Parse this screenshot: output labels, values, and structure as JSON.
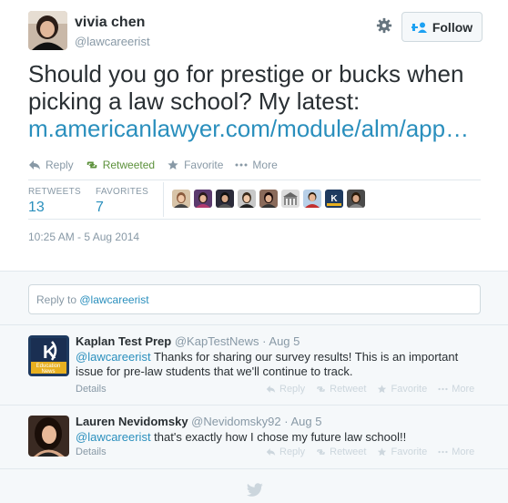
{
  "tweet": {
    "fullname": "vivia chen",
    "username": "@lawcareerist",
    "follow_label": "Follow",
    "text_line1": "Should you go for prestige or bucks when",
    "text_line2": "picking a law school? My latest:",
    "link": "m.americanlawyer.com/module/alm/app…",
    "actions": {
      "reply": "Reply",
      "retweeted": "Retweeted",
      "favorite": "Favorite",
      "more": "More"
    },
    "stats": {
      "retweets_label": "RETWEETS",
      "retweets_value": "13",
      "favorites_label": "FAVORITES",
      "favorites_value": "7"
    },
    "timestamp": "10:25 AM - 5 Aug 2014"
  },
  "reply_box": {
    "prefix": "Reply to ",
    "mention": "@lawcareerist"
  },
  "replies": [
    {
      "name": "Kaplan Test Prep",
      "handle": "@KapTestNews",
      "date": "· Aug 5",
      "mention": "@lawcareerist",
      "text": " Thanks for sharing our survey results! This is an important issue for pre-law students that we'll continue to track.",
      "details": "Details",
      "reply": "Reply",
      "retweet": "Retweet",
      "favorite": "Favorite",
      "more": "More",
      "avatar_text_k": "K",
      "avatar_text_1": "Education",
      "avatar_text_2": "News"
    },
    {
      "name": "Lauren Nevidomsky",
      "handle": "@Nevidomsky92",
      "date": "· Aug 5",
      "mention": "@lawcareerist",
      "text": " that's exactly how I chose my future law school!!",
      "details": "Details",
      "reply": "Reply",
      "retweet": "Retweet",
      "favorite": "Favorite",
      "more": "More"
    }
  ],
  "colors": {
    "link": "#2a8fbd",
    "retweeted": "#5c913b",
    "muted": "#8899a6",
    "kaplan_bg": "#1e3a5f"
  }
}
